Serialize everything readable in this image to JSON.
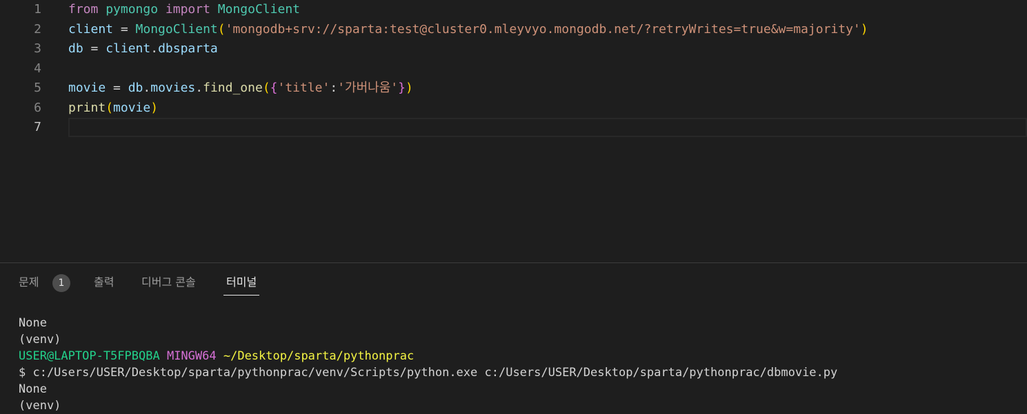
{
  "editor": {
    "lines": [
      {
        "num": "1",
        "tokens": [
          [
            "kw",
            "from"
          ],
          [
            "op",
            " "
          ],
          [
            "mod",
            "pymongo"
          ],
          [
            "op",
            " "
          ],
          [
            "kw",
            "import"
          ],
          [
            "op",
            " "
          ],
          [
            "mod",
            "MongoClient"
          ]
        ]
      },
      {
        "num": "2",
        "tokens": [
          [
            "var",
            "client"
          ],
          [
            "op",
            " = "
          ],
          [
            "mod",
            "MongoClient"
          ],
          [
            "p1",
            "("
          ],
          [
            "str",
            "'mongodb+srv://sparta:test@cluster0.mleyvyo.mongodb.net/?retryWrites=true&w=majority'"
          ],
          [
            "p1",
            ")"
          ]
        ]
      },
      {
        "num": "3",
        "tokens": [
          [
            "var",
            "db"
          ],
          [
            "op",
            " = "
          ],
          [
            "var",
            "client"
          ],
          [
            "op",
            "."
          ],
          [
            "var",
            "dbsparta"
          ]
        ]
      },
      {
        "num": "4",
        "tokens": []
      },
      {
        "num": "5",
        "tokens": [
          [
            "var",
            "movie"
          ],
          [
            "op",
            " = "
          ],
          [
            "var",
            "db"
          ],
          [
            "op",
            "."
          ],
          [
            "var",
            "movies"
          ],
          [
            "op",
            "."
          ],
          [
            "fn",
            "find_one"
          ],
          [
            "p1",
            "("
          ],
          [
            "p2",
            "{"
          ],
          [
            "str",
            "'title'"
          ],
          [
            "op",
            ":"
          ],
          [
            "str",
            "'가버나움'"
          ],
          [
            "p2",
            "}"
          ],
          [
            "p1",
            ")"
          ]
        ]
      },
      {
        "num": "6",
        "tokens": [
          [
            "fn",
            "print"
          ],
          [
            "p1",
            "("
          ],
          [
            "var",
            "movie"
          ],
          [
            "p1",
            ")"
          ]
        ]
      },
      {
        "num": "7",
        "tokens": []
      }
    ],
    "active_line": "7"
  },
  "panel": {
    "tabs": [
      {
        "label": "문제",
        "badge": "1"
      },
      {
        "label": "출력"
      },
      {
        "label": "디버그 콘솔"
      },
      {
        "label": "터미널",
        "active": true
      }
    ],
    "terminal": {
      "line1": "None",
      "line2": "(venv)",
      "prompt_user": "USER@LAPTOP-T5FPBQBA",
      "prompt_shell": "MINGW64",
      "prompt_path": "~/Desktop/sparta/pythonprac",
      "command": "$ c:/Users/USER/Desktop/sparta/pythonprac/venv/Scripts/python.exe c:/Users/USER/Desktop/sparta/pythonprac/dbmovie.py",
      "line5": "None",
      "line6": "(venv)"
    }
  }
}
